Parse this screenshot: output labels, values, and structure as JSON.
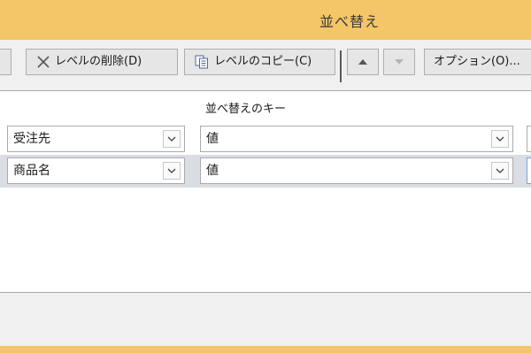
{
  "window": {
    "title": "並べ替え"
  },
  "toolbar": {
    "add_label": ")",
    "delete_label": "レベルの削除(D)",
    "copy_label": "レベルのコピー(C)",
    "options_label": "オプション(O)..."
  },
  "header": {
    "key_label": "並べ替えのキー"
  },
  "rows": [
    {
      "column": "受注先",
      "sort_on": "値"
    },
    {
      "column": "商品名",
      "sort_on": "値"
    }
  ],
  "icons": {
    "delete": "x-icon",
    "copy": "copy-icon",
    "move_up": "triangle-up-icon",
    "move_down": "triangle-down-icon",
    "dropdown": "chevron-down-icon"
  },
  "colors": {
    "title_bar": "#f4c668",
    "selected_row": "#dadde3",
    "toolbar_bg": "#f0f0f0"
  }
}
